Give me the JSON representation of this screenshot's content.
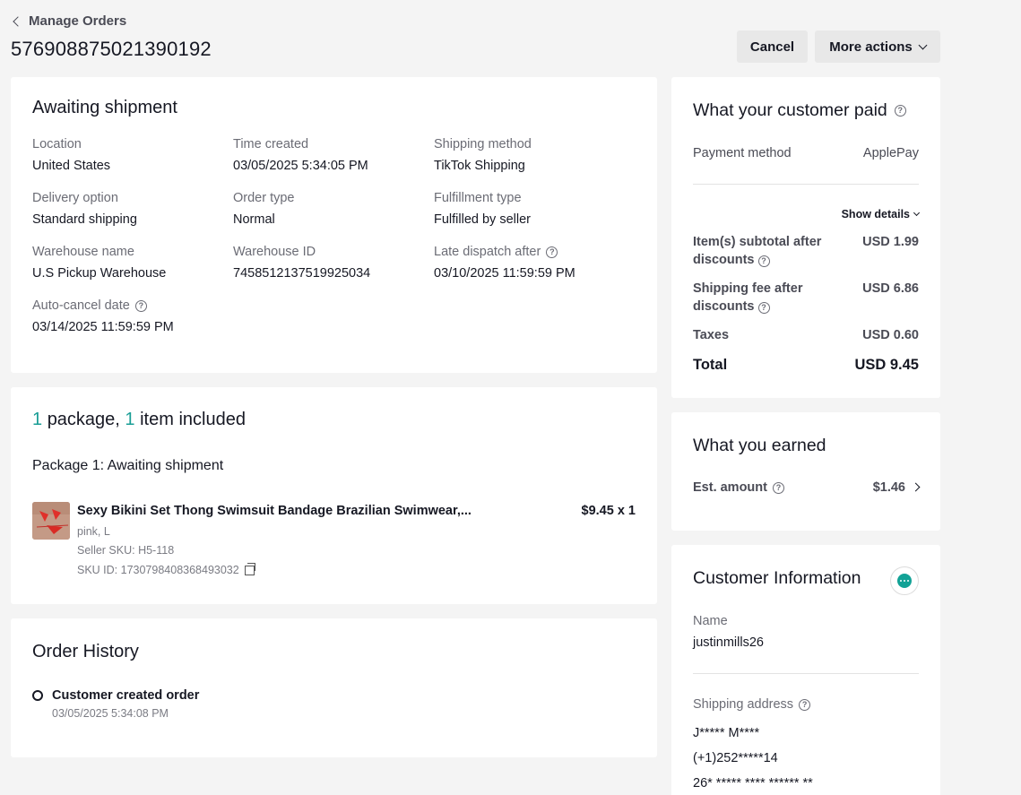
{
  "header": {
    "back_label": "Manage Orders",
    "order_id": "576908875021390192",
    "cancel_label": "Cancel",
    "more_actions_label": "More actions"
  },
  "status": {
    "title": "Awaiting shipment",
    "fields": [
      {
        "label": "Location",
        "value": "United States"
      },
      {
        "label": "Time created",
        "value": "03/05/2025 5:34:05 PM"
      },
      {
        "label": "Shipping method",
        "value": "TikTok Shipping"
      },
      {
        "label": "Delivery option",
        "value": "Standard shipping"
      },
      {
        "label": "Order type",
        "value": "Normal"
      },
      {
        "label": "Fulfillment type",
        "value": "Fulfilled by seller"
      },
      {
        "label": "Warehouse name",
        "value": "U.S Pickup Warehouse"
      },
      {
        "label": "Warehouse ID",
        "value": "7458512137519925034"
      },
      {
        "label": "Late dispatch after",
        "value": "03/10/2025 11:59:59 PM"
      },
      {
        "label": "Auto-cancel date",
        "value": "03/14/2025 11:59:59 PM"
      }
    ]
  },
  "package": {
    "package_count": "1",
    "package_text": "package,",
    "item_count": "1",
    "item_text": "item included",
    "subtitle": "Package 1: Awaiting shipment",
    "product": {
      "name": "Sexy Bikini Set Thong Swimsuit Bandage Brazilian Swimwear,...",
      "price": "$9.45 x 1",
      "variant": "pink, L",
      "seller_sku": "Seller SKU: H5-118",
      "sku_id": "SKU ID: 1730798408368493032"
    }
  },
  "history": {
    "title": "Order History",
    "event": "Customer created order",
    "time": "03/05/2025 5:34:08 PM"
  },
  "paid": {
    "title": "What your customer paid",
    "payment_method_label": "Payment method",
    "payment_method_value": "ApplePay",
    "show_details": "Show details",
    "subtotal_label_1": "Item(s) subtotal after",
    "subtotal_label_2": "discounts",
    "subtotal_value": "USD 1.99",
    "shipping_label_1": "Shipping fee after",
    "shipping_label_2": "discounts",
    "shipping_value": "USD 6.86",
    "taxes_label": "Taxes",
    "taxes_value": "USD 0.60",
    "total_label": "Total",
    "total_value": "USD 9.45"
  },
  "earned": {
    "title": "What you earned",
    "est_label": "Est. amount",
    "est_value": "$1.46"
  },
  "customer": {
    "title": "Customer Information",
    "name_label": "Name",
    "name_value": "justinmills26",
    "address_label": "Shipping address",
    "address_lines": [
      "J***** M****",
      "(+1)252*****14",
      "26* ***** **** ****** **"
    ]
  },
  "colors": {
    "accent_teal": "#1a9e96",
    "chat_icon": "#12a296",
    "background": "#f4f4f4"
  }
}
